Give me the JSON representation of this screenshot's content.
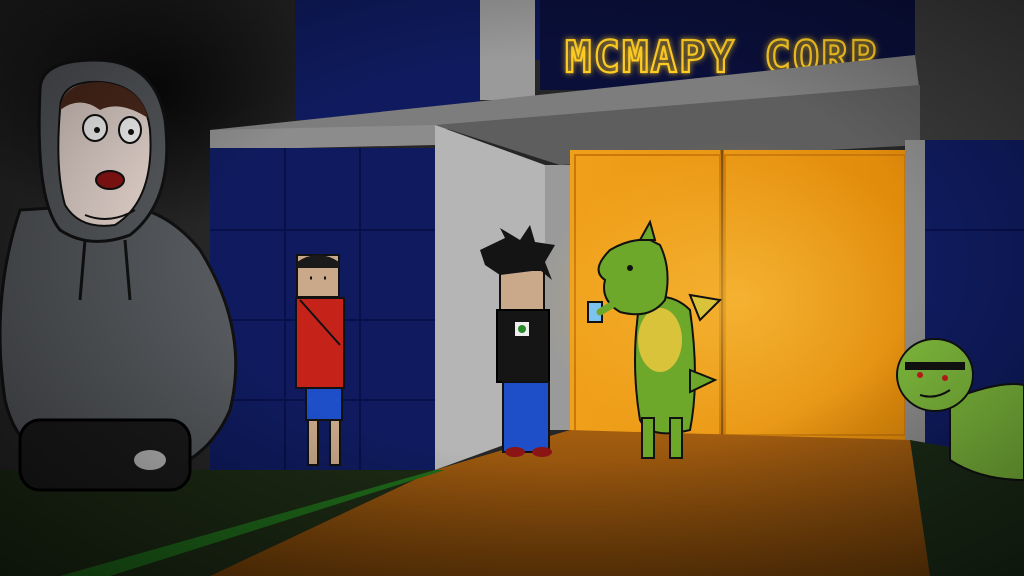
{
  "scene": {
    "sign_text": "MCMAPY CORP",
    "colors": {
      "sky": "#2b2b2b",
      "building_blue": "#0e1a5c",
      "sign_neon": "#e6b400",
      "door_orange": "#e8950e",
      "floor_orange": "#b86a10",
      "grass": "#1f6a1a",
      "dragon_green": "#6da82a",
      "dragon_belly": "#d8c33b",
      "hoodie_gray": "#55585c"
    },
    "characters": [
      "hooded-large-figure",
      "boy-red-shirt",
      "spiky-hair-boy",
      "green-dragon",
      "green-zombie"
    ]
  }
}
